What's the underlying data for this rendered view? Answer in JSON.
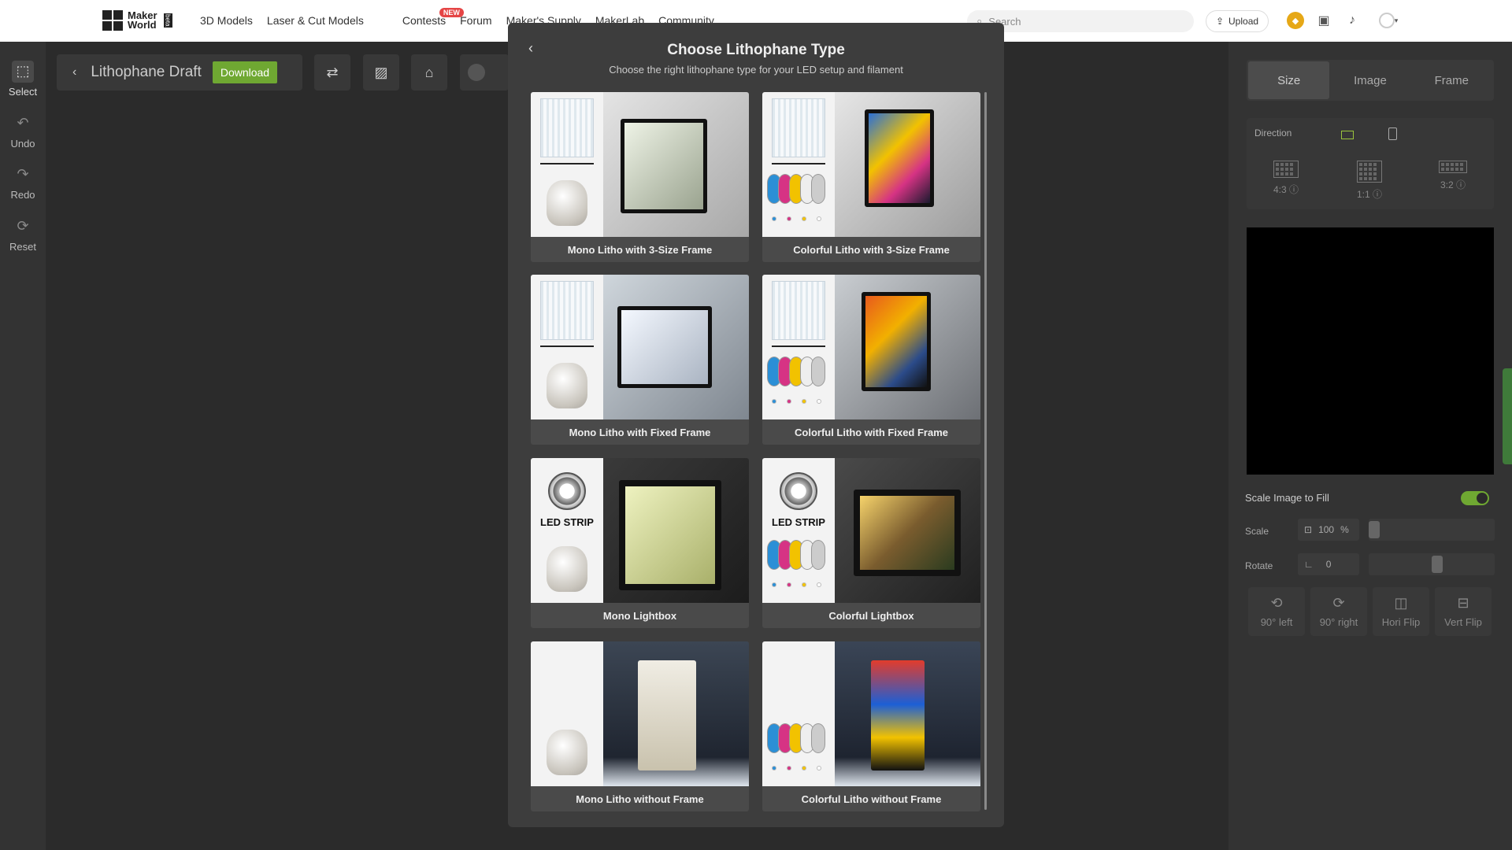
{
  "topbar": {
    "logo_line1": "Maker",
    "logo_line2": "World",
    "logo_badge": "beta",
    "nav": [
      "3D Models",
      "Laser & Cut Models",
      "Contests",
      "Forum",
      "Maker's Supply",
      "MakerLab",
      "Community"
    ],
    "new_badge": "NEW",
    "search_placeholder": "Search",
    "upload_label": "Upload"
  },
  "tools": [
    {
      "label": "Select",
      "icon": "select-icon"
    },
    {
      "label": "Undo",
      "icon": "undo-icon"
    },
    {
      "label": "Redo",
      "icon": "redo-icon"
    },
    {
      "label": "Reset",
      "icon": "reset-icon"
    }
  ],
  "draft": {
    "title": "Lithophane Draft",
    "download_label": "Download"
  },
  "right_panel": {
    "tabs": [
      "Size",
      "Image",
      "Frame"
    ],
    "active_tab": "Size",
    "direction_label": "Direction",
    "ratios": [
      "4:3",
      "1:1",
      "3:2"
    ],
    "scale_fill_label": "Scale Image to Fill",
    "scale_fill_on": true,
    "scale_label": "Scale",
    "scale_value": "100",
    "scale_unit": "%",
    "rotate_label": "Rotate",
    "rotate_value": "0",
    "actions": [
      "90° left",
      "90° right",
      "Hori Flip",
      "Vert Flip"
    ]
  },
  "modal": {
    "title": "Choose Lithophane Type",
    "subtitle": "Choose the right lithophane type for your LED setup and filament",
    "led_text": "LED STRIP",
    "cards": [
      {
        "label": "Mono Litho with 3-Size Frame",
        "kind": "mono",
        "thumb": "panel"
      },
      {
        "label": "Colorful Litho with 3-Size Frame",
        "kind": "color",
        "thumb": "panel"
      },
      {
        "label": "Mono Litho with Fixed Frame",
        "kind": "mono",
        "thumb": "panel"
      },
      {
        "label": "Colorful Litho with Fixed Frame",
        "kind": "color",
        "thumb": "panel"
      },
      {
        "label": "Mono Lightbox",
        "kind": "mono",
        "thumb": "led"
      },
      {
        "label": "Colorful Lightbox",
        "kind": "color",
        "thumb": "led"
      },
      {
        "label": "Mono Litho without Frame",
        "kind": "mono",
        "thumb": "none"
      },
      {
        "label": "Colorful Litho without Frame",
        "kind": "color",
        "thumb": "none"
      }
    ]
  },
  "colors": {
    "accent_green": "#6fa832",
    "cyan": "#2b8fd6",
    "magenta": "#d63384",
    "yellow": "#f2c200",
    "white": "#ffffff"
  }
}
